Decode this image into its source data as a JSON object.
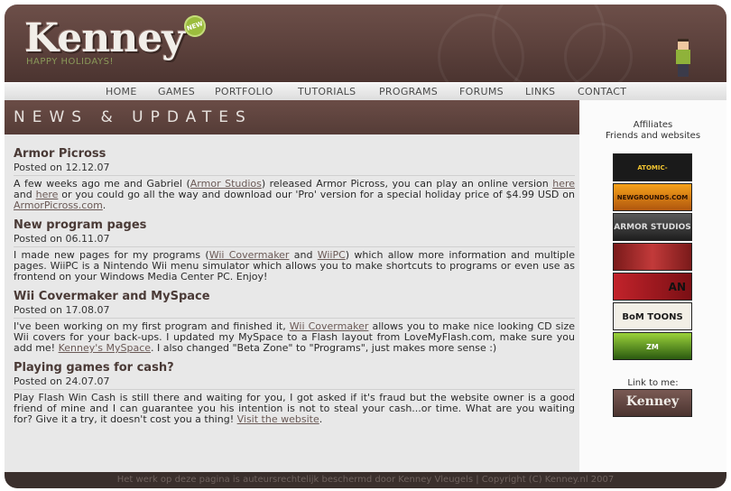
{
  "header": {
    "logo_text": "Kenney",
    "badge": "NEW",
    "tagline": "HAPPY HOLIDAYS!"
  },
  "nav": [
    "HOME",
    "GAMES",
    "PORTFOLIO",
    "TUTORIALS",
    "PROGRAMS",
    "FORUMS",
    "LINKS",
    "CONTACT"
  ],
  "banner": "NEWS & UPDATES",
  "posts": [
    {
      "title": "Armor Picross",
      "date": "Posted on 12.12.07",
      "t1": "A few weeks ago me and Gabriel (",
      "l1": "Armor Studios",
      "t2": ") released Armor Picross, you can play an online version ",
      "l2": "here",
      "t3": " and ",
      "l3": "here",
      "t4": " or you could go all the way and download our 'Pro' version for a special holiday price of $4.99 USD on ",
      "l4": "ArmorPicross.com",
      "t5": "."
    },
    {
      "title": "New program pages",
      "date": "Posted on 06.11.07",
      "t1": "I made new pages for my programs (",
      "l1": "Wii Covermaker",
      "t2": " and ",
      "l2": "WiiPC",
      "t3": ") which allow more information and multiple pages. WiiPC is a Nintendo Wii menu simulator which allows you to make shortcuts to programs or even use as frontend on your Windows Media Center PC. Enjoy!"
    },
    {
      "title": "Wii Covermaker and MySpace",
      "date": "Posted on 17.08.07",
      "t1": "I've been working on my first program and finished it, ",
      "l1": "Wii Covermaker",
      "t2": " allows you to make nice looking CD size Wii covers for your back-ups. I updated my MySpace to a Flash layout from LoveMyFlash.com, make sure you add me! ",
      "l2": "Kenney's MySpace",
      "t3": ". I also changed \"Beta Zone\" to \"Programs\", just makes more sense :)"
    },
    {
      "title": "Playing games for cash?",
      "date": "Posted on 24.07.07",
      "t1": "Play Flash Win Cash is still there and waiting for you, I got asked if it's fraud but the website owner is a good friend of mine and I can guarantee you his intention is not to steal your cash...or time. What are you waiting for? Give it a try, it doesn't cost you a thing! ",
      "l1": "Visit the website",
      "t2": "."
    }
  ],
  "sidebar": {
    "affiliates_title": "Affiliates",
    "affiliates_sub": "Friends and websites",
    "buttons": [
      "ATOMIC-NOODLE.COM",
      "NEWGROUNDS.COM",
      "ARMOR STUDIOS",
      "",
      "AN",
      "BoM TOONS",
      "ZM ZELLOMESH.COM"
    ],
    "link_to_me": "Link to me:",
    "link_button": "Kenney"
  },
  "footer": "Het werk op deze pagina is auteursrechtelijk beschermd door Kenney Vleugels | Copyright (C) Kenney.nl 2007"
}
